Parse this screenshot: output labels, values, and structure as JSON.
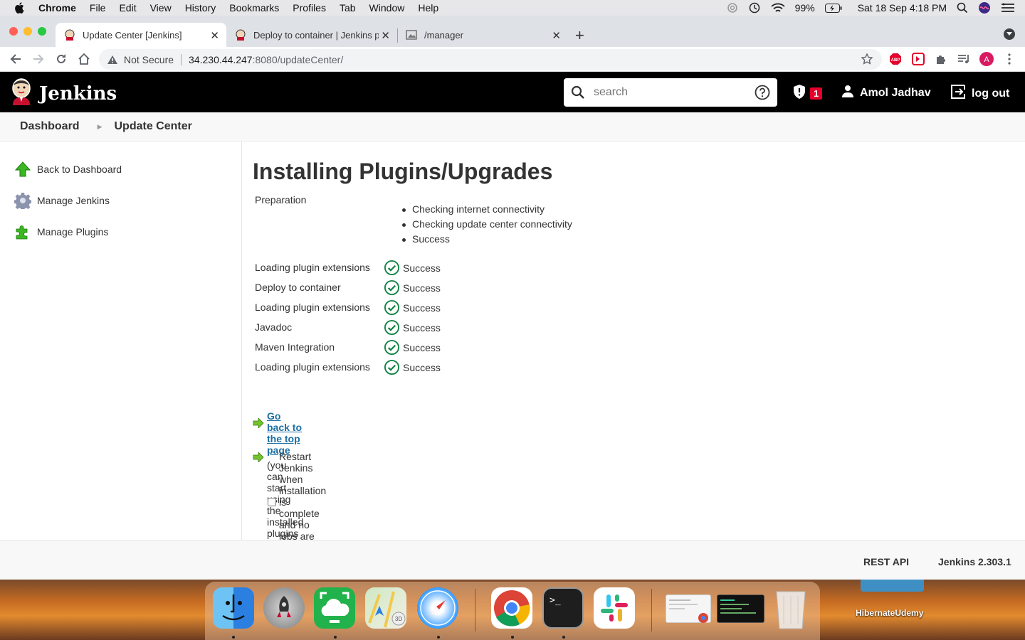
{
  "menubar": {
    "app": "Chrome",
    "items": [
      "File",
      "Edit",
      "View",
      "History",
      "Bookmarks",
      "Profiles",
      "Tab",
      "Window",
      "Help"
    ],
    "battery": "99%",
    "datetime": "Sat 18 Sep  4:18 PM"
  },
  "tabs": [
    {
      "title": "Update Center [Jenkins]",
      "icon": "jenkins-favicon-icon",
      "active": true
    },
    {
      "title": "Deploy to container | Jenkins p",
      "icon": "jenkins-favicon-icon",
      "active": false
    },
    {
      "title": "/manager",
      "icon": "broken-image-icon",
      "active": false
    }
  ],
  "omnibox": {
    "security": "Not Secure",
    "host": "34.230.44.247",
    "path": ":8080/updateCenter/"
  },
  "jenkins": {
    "brand": "Jenkins",
    "search_placeholder": "search",
    "alert_count": "1",
    "user": "Amol Jadhav",
    "logout": "log out"
  },
  "breadcrumb": [
    "Dashboard",
    "Update Center"
  ],
  "sidebar": [
    {
      "label": "Back to Dashboard",
      "icon": "up-arrow-icon"
    },
    {
      "label": "Manage Jenkins",
      "icon": "gear-icon"
    },
    {
      "label": "Manage Plugins",
      "icon": "puzzle-icon"
    }
  ],
  "main": {
    "title": "Installing Plugins/Upgrades",
    "preparation_label": "Preparation",
    "preparation_steps": [
      "Checking internet connectivity",
      "Checking update center connectivity",
      "Success"
    ],
    "rows": [
      {
        "label": "Loading plugin extensions",
        "status": "Success"
      },
      {
        "label": "Deploy to container",
        "status": "Success"
      },
      {
        "label": "Loading plugin extensions",
        "status": "Success"
      },
      {
        "label": "Javadoc",
        "status": "Success"
      },
      {
        "label": "Maven Integration",
        "status": "Success"
      },
      {
        "label": "Loading plugin extensions",
        "status": "Success"
      }
    ],
    "top_link": "Go back to the top page",
    "top_note": "(you can start using the installed plugins right away)",
    "restart_label": "Restart Jenkins when installation is complete and no jobs are running"
  },
  "footer": {
    "rest_api": "REST API",
    "version": "Jenkins 2.303.1"
  },
  "dock": {
    "apps": [
      "Finder",
      "Launchpad",
      "Screen Sharing",
      "Maps",
      "Safari",
      "Chrome",
      "Terminal",
      "Slack",
      "Preview window",
      "Terminal window",
      "Trash"
    ],
    "desktop_label": "HibernateUdemy"
  },
  "colors": {
    "jenkins_header": "#000000",
    "badge_red": "#e4002b",
    "success_green": "#138347",
    "link_blue": "#1d6fa5"
  }
}
